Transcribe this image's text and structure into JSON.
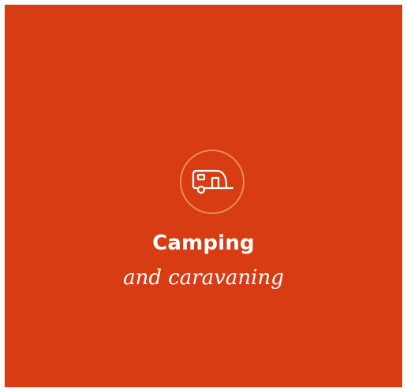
{
  "card": {
    "title": "Camping",
    "subtitle": "and caravaning",
    "icon": "caravan-icon",
    "background_color": "#d83c13",
    "ring_color": "#ee8a5a",
    "text_color": "#ffffff"
  }
}
